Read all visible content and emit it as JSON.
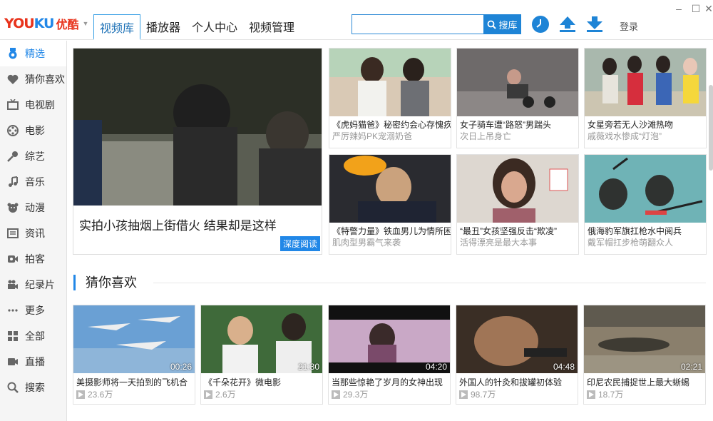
{
  "app": {
    "logo_text_a": "YOU",
    "logo_text_b": "KU",
    "logo_cn": "优酷"
  },
  "nav": {
    "tabs": [
      "视频库",
      "播放器",
      "个人中心",
      "视频管理"
    ]
  },
  "search": {
    "value": "",
    "button_label": "搜库"
  },
  "header": {
    "login_label": "登录"
  },
  "sidebar": {
    "items": [
      {
        "label": "精选",
        "icon": "medal-icon"
      },
      {
        "label": "猜你喜欢",
        "icon": "heart-icon"
      },
      {
        "label": "电视剧",
        "icon": "tv-icon"
      },
      {
        "label": "电影",
        "icon": "film-reel-icon"
      },
      {
        "label": "综艺",
        "icon": "microphone-icon"
      },
      {
        "label": "音乐",
        "icon": "music-note-icon"
      },
      {
        "label": "动漫",
        "icon": "bear-icon"
      },
      {
        "label": "资讯",
        "icon": "news-icon"
      },
      {
        "label": "拍客",
        "icon": "camera-icon"
      },
      {
        "label": "纪录片",
        "icon": "video-camera-icon"
      },
      {
        "label": "更多",
        "icon": "more-icon"
      },
      {
        "label": "全部",
        "icon": "grid-icon"
      },
      {
        "label": "直播",
        "icon": "live-camera-icon"
      },
      {
        "label": "搜索",
        "icon": "search-icon"
      }
    ]
  },
  "featured": {
    "hero": {
      "title": "实拍小孩抽烟上街借火 结果却是这样",
      "tag": "深度阅读"
    },
    "cards": [
      {
        "title": "《虎妈猫爸》秘密约会心存愧疚",
        "subtitle": "严厉辣妈PK宠溺奶爸"
      },
      {
        "title": "女子骑车遭“路怒”男踹头",
        "subtitle": "次日上吊身亡"
      },
      {
        "title": "女星旁若无人沙滩热吻",
        "subtitle": "戚薇戏水惨成“灯泡”"
      },
      {
        "title": "《特警力量》铁血男儿为情所困",
        "subtitle": "肌肉型男霸气来袭"
      },
      {
        "title": "“最丑”女孩坚强反击“欺凌”",
        "subtitle": "活得漂亮是最大本事"
      },
      {
        "title": "俄海豹军旗扛枪水中阅兵",
        "subtitle": "戴军帽扛步枪萌翻众人"
      }
    ]
  },
  "guess": {
    "section_title": "猜你喜欢",
    "videos": [
      {
        "title": "美摄影师将一天拍到的飞机合",
        "views": "23.6万",
        "duration": "00:26"
      },
      {
        "title": "《千朵花开》微电影",
        "views": "2.6万",
        "duration": "21:30"
      },
      {
        "title": "当那些惊艳了岁月的女神出现",
        "views": "29.3万",
        "duration": "04:20"
      },
      {
        "title": "外国人的针灸和拔罐初体验",
        "views": "98.7万",
        "duration": "04:48"
      },
      {
        "title": "印尼农民捕捉世上最大蜥蜴",
        "views": "18.7万",
        "duration": "02:21"
      }
    ]
  },
  "colors": {
    "accent": "#2187e7",
    "brand_red": "#e8331c"
  }
}
